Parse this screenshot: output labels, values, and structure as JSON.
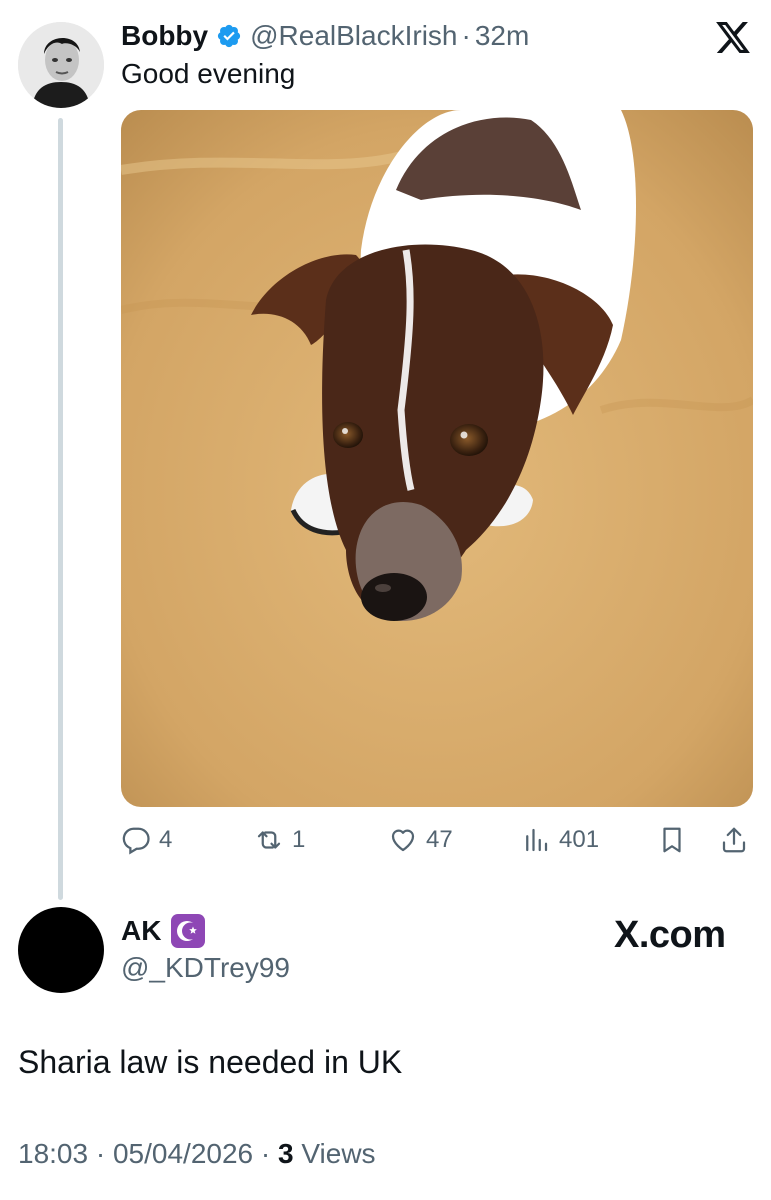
{
  "tweet": {
    "author_name": "Bobby",
    "author_handle": "@RealBlackIrish",
    "separator": "·",
    "time_ago": "32m",
    "text": "Good evening",
    "replies": "4",
    "reposts": "1",
    "likes": "47",
    "views": "401"
  },
  "quote": {
    "author_name": "AK",
    "author_handle": "@_KDTrey99",
    "site": "X.com",
    "text": "Sharia law is needed in UK",
    "time": "18:03",
    "separator": "·",
    "date": "05/04/2026",
    "views_count": "3",
    "views_label": "Views"
  },
  "icons": {
    "verified": "verified-badge-icon",
    "x_logo": "x-logo-icon",
    "reply": "reply-icon",
    "repost": "repost-icon",
    "like": "heart-icon",
    "views": "views-icon",
    "bookmark": "bookmark-icon",
    "share": "share-icon",
    "crescent": "star-crescent-icon"
  },
  "colors": {
    "verified_blue": "#1d9bf0",
    "secondary_text": "#536471",
    "crescent_badge": "#8e47b5"
  }
}
